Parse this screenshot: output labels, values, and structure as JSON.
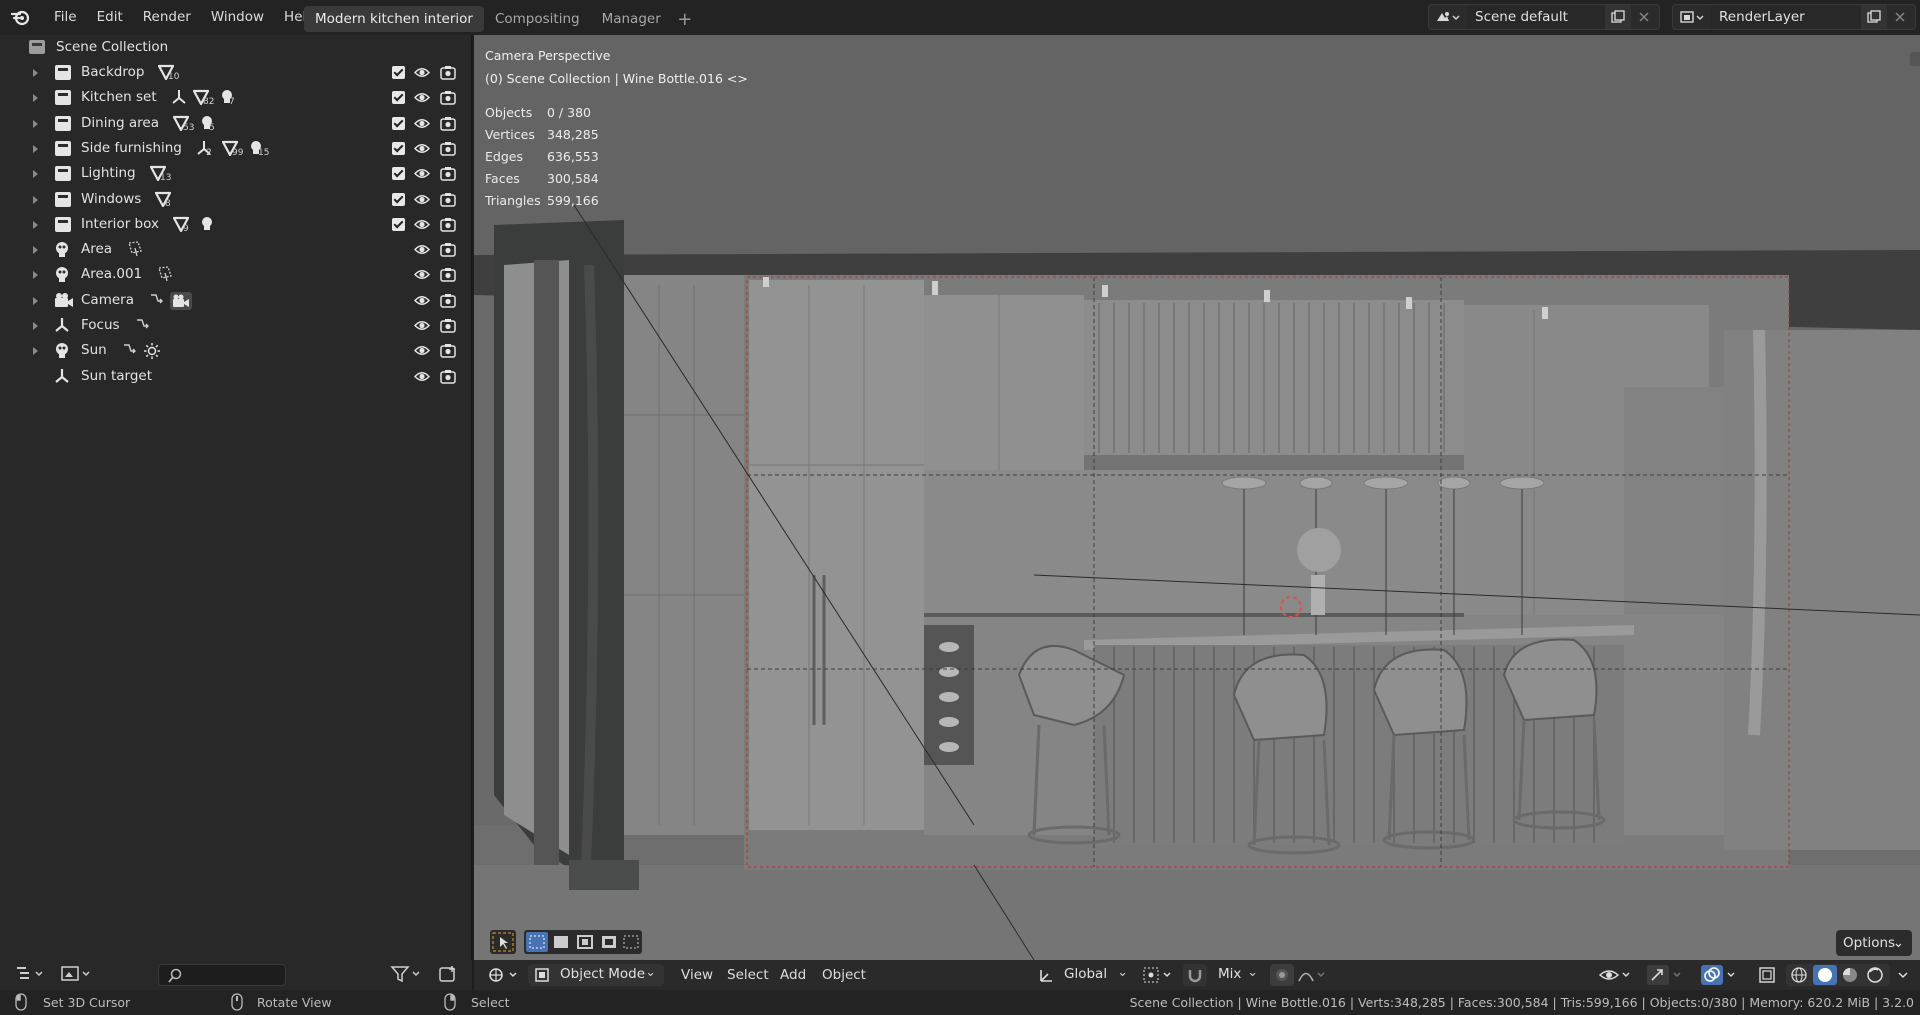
{
  "menu": [
    "File",
    "Edit",
    "Render",
    "Window",
    "Help"
  ],
  "workspace_tabs": [
    {
      "label": "Modern kitchen interior",
      "active": true
    },
    {
      "label": "Compositing",
      "active": false
    },
    {
      "label": "Manager",
      "active": false
    }
  ],
  "scene": {
    "name": "Scene default"
  },
  "view_layer": {
    "name": "RenderLayer"
  },
  "outliner": {
    "root": "Scene Collection",
    "items": [
      {
        "label": "Backdrop",
        "type": "collection",
        "badges": [
          {
            "icon": "mesh-icon",
            "count": "10"
          }
        ],
        "checkbox": true
      },
      {
        "label": "Kitchen set",
        "type": "collection",
        "badges": [
          {
            "icon": "empty-icon",
            "count": ""
          },
          {
            "icon": "mesh-icon",
            "count": "82"
          },
          {
            "icon": "light-icon",
            "count": "7"
          }
        ],
        "checkbox": true
      },
      {
        "label": "Dining area",
        "type": "collection",
        "badges": [
          {
            "icon": "mesh-icon",
            "count": "53"
          },
          {
            "icon": "light-icon",
            "count": "5"
          }
        ],
        "checkbox": true
      },
      {
        "label": "Side furnishing",
        "type": "collection",
        "badges": [
          {
            "icon": "empty-icon",
            "count": "2"
          },
          {
            "icon": "mesh-icon",
            "count": "99"
          },
          {
            "icon": "light-icon",
            "count": "15"
          }
        ],
        "checkbox": true
      },
      {
        "label": "Lighting",
        "type": "collection",
        "badges": [
          {
            "icon": "mesh-icon",
            "count": "13"
          }
        ],
        "checkbox": true
      },
      {
        "label": "Windows",
        "type": "collection",
        "badges": [
          {
            "icon": "mesh-icon",
            "count": "8"
          }
        ],
        "checkbox": true
      },
      {
        "label": "Interior box",
        "type": "collection",
        "badges": [
          {
            "icon": "mesh-icon",
            "count": "9"
          },
          {
            "icon": "light-icon",
            "count": ""
          }
        ],
        "checkbox": true
      },
      {
        "label": "Area",
        "type": "light",
        "badges": [
          {
            "icon": "area-light-data-icon",
            "count": ""
          }
        ],
        "checkbox": false
      },
      {
        "label": "Area.001",
        "type": "light",
        "badges": [
          {
            "icon": "area-light-data-icon",
            "count": ""
          }
        ],
        "checkbox": false
      },
      {
        "label": "Camera",
        "type": "camera",
        "badges": [
          {
            "icon": "constraint-icon",
            "count": ""
          },
          {
            "icon": "camera-data-icon",
            "count": ""
          }
        ],
        "checkbox": false
      },
      {
        "label": "Focus",
        "type": "empty",
        "badges": [
          {
            "icon": "constraint-icon",
            "count": ""
          }
        ],
        "checkbox": false
      },
      {
        "label": "Sun",
        "type": "light",
        "badges": [
          {
            "icon": "constraint-icon",
            "count": ""
          },
          {
            "icon": "sun-data-icon",
            "count": ""
          }
        ],
        "checkbox": false
      },
      {
        "label": "Sun target",
        "type": "empty",
        "badges": [],
        "checkbox": false,
        "no_arrow": true
      }
    ]
  },
  "viewport": {
    "title": "Camera Perspective",
    "context": "(0) Scene Collection | Wine Bottle.016 <>",
    "stats": [
      {
        "label": "Objects",
        "value": "0 / 380"
      },
      {
        "label": "Vertices",
        "value": "348,285"
      },
      {
        "label": "Edges",
        "value": "636,553"
      },
      {
        "label": "Faces",
        "value": "300,584"
      },
      {
        "label": "Triangles",
        "value": "599,166"
      }
    ],
    "options_label": "Options"
  },
  "header": {
    "mode": "Object Mode",
    "menus": [
      "View",
      "Select",
      "Add",
      "Object"
    ],
    "orientation": "Global",
    "snap_mix": "Mix"
  },
  "status": {
    "left": "Set 3D Cursor",
    "middle": "Rotate View",
    "right": "Select",
    "info": "Scene Collection | Wine Bottle.016 | Verts:348,285 | Faces:300,584 | Tris:599,166 | Objects:0/380 | Memory: 620.2 MiB | 3.2.0"
  },
  "colors": {
    "accent": "#4772b3",
    "bg": "#1d1d1d",
    "panel": "#282828"
  }
}
